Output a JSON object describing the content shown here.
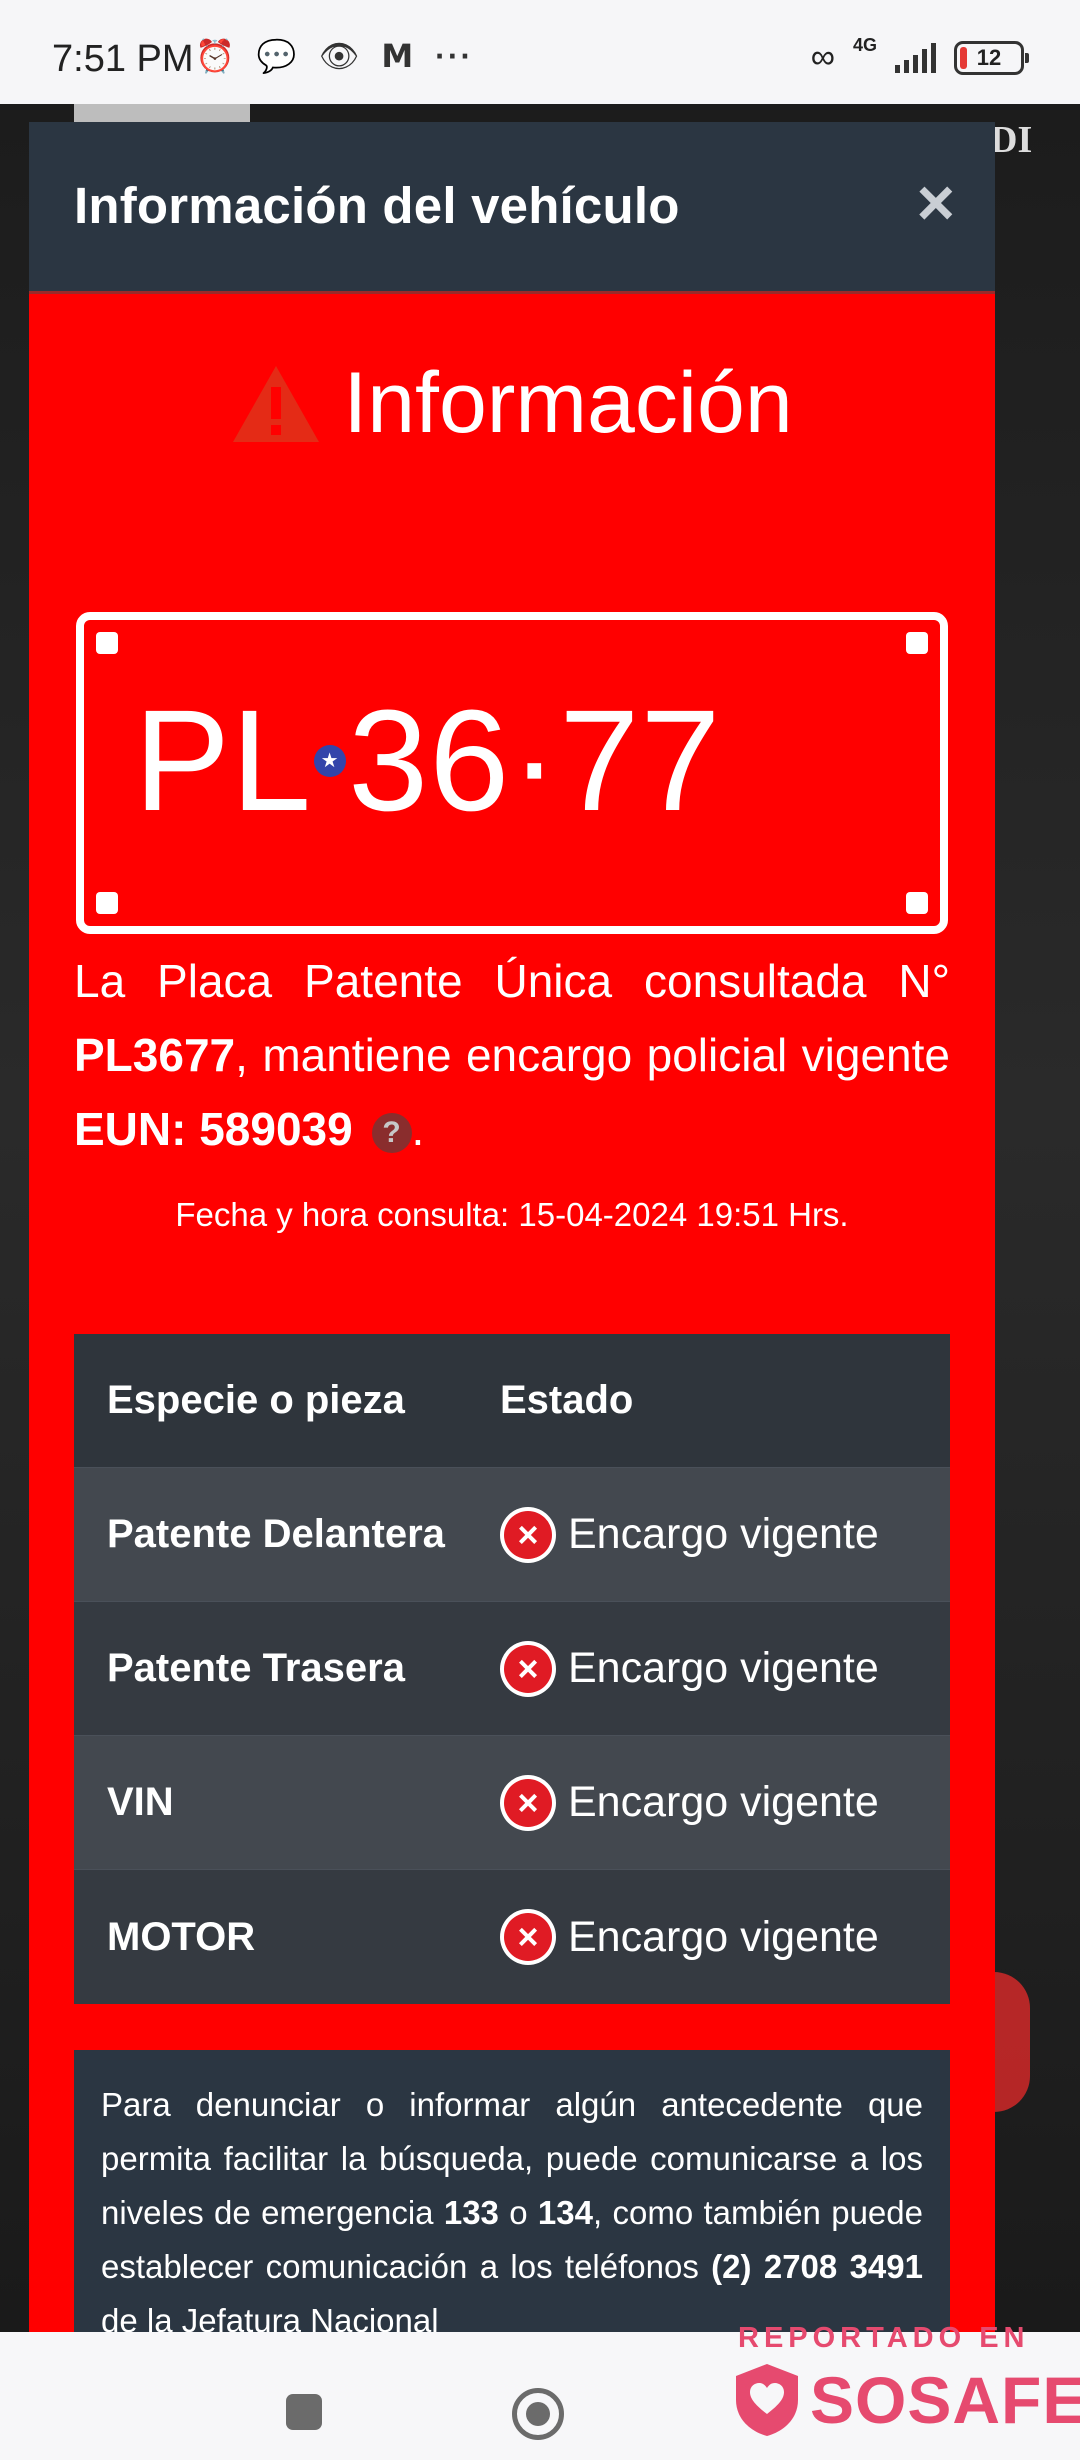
{
  "status_bar": {
    "time": "7:51 PM",
    "network": "4G",
    "battery": "12",
    "icons": [
      "alarm-icon",
      "chat-bubble-icon",
      "eye-icon",
      "gmail-icon",
      "more-dots-icon",
      "link-icon",
      "signal-icon",
      "battery-icon"
    ]
  },
  "modal": {
    "title": "Información del vehículo",
    "close_symbol": "×"
  },
  "info": {
    "heading": "Información",
    "plate_left": "PL",
    "plate_mid": "36",
    "plate_sep": "·",
    "plate_right": "77",
    "plate_star": "★",
    "msg_part1": "La Placa Patente Única consultada N°",
    "plate_bold": "PL3677",
    "msg_part2": ", mantiene encargo policial vigente",
    "eun_label": "EUN: 589039",
    "help_symbol": "?",
    "msg_end": ".",
    "datetime": "Fecha y hora consulta: 15-04-2024 19:51 Hrs."
  },
  "table": {
    "headers": [
      "Especie o pieza",
      "Estado"
    ],
    "rows": [
      {
        "item": "Patente Delantera",
        "status": "Encargo vigente"
      },
      {
        "item": "Patente Trasera",
        "status": "Encargo vigente"
      },
      {
        "item": "VIN",
        "status": "Encargo vigente"
      },
      {
        "item": "MOTOR",
        "status": "Encargo vigente"
      }
    ],
    "status_icon": "×"
  },
  "notice": {
    "p1": "Para denunciar o informar algún antecedente que permita facilitar la búsqueda, puede comunicarse a los niveles de emergencia ",
    "n1": "133",
    "p2": " o ",
    "n2": "134",
    "p3": ", como también puede establecer comunicación a los teléfonos ",
    "phone": "(2) 2708 3491",
    "p4": " de la Jefatura Nacional"
  },
  "background": {
    "logo": "DI"
  },
  "watermark": {
    "top": "REPORTADO EN",
    "brand": "SOSAFE"
  },
  "colors": {
    "alert_red": "#ff0000",
    "header": "#2b3642",
    "watermark": "#e64a6f"
  }
}
